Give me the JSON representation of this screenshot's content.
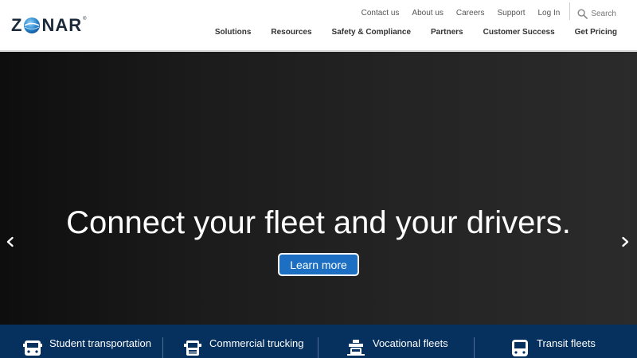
{
  "brand": {
    "logo_text_before": "Z",
    "logo_text_after": "NAR",
    "registered_mark": "®",
    "accent": "#1c6fc2",
    "navy": "#06315f"
  },
  "utility_nav": [
    {
      "label": "Contact us"
    },
    {
      "label": "About us"
    },
    {
      "label": "Careers"
    },
    {
      "label": "Support"
    },
    {
      "label": "Log In"
    }
  ],
  "search": {
    "label": "Search",
    "icon": "search-icon"
  },
  "main_nav": [
    {
      "label": "Solutions"
    },
    {
      "label": "Resources"
    },
    {
      "label": "Safety & Compliance"
    },
    {
      "label": "Partners"
    },
    {
      "label": "Customer Success"
    },
    {
      "label": "Get Pricing"
    }
  ],
  "hero": {
    "heading": "Connect your fleet and your drivers.",
    "button_label": "Learn more",
    "prev_icon": "chevron-left-icon",
    "next_icon": "chevron-right-icon"
  },
  "fleets": [
    {
      "label": "Student transportation",
      "icon": "school-bus-icon"
    },
    {
      "label": "Commercial trucking",
      "icon": "truck-icon"
    },
    {
      "label": "Vocational fleets",
      "icon": "vocational-vehicle-icon"
    },
    {
      "label": "Transit fleets",
      "icon": "transit-bus-icon"
    }
  ]
}
